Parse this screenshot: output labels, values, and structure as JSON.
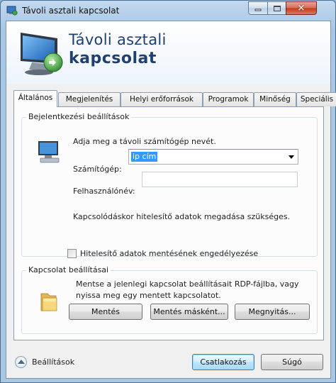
{
  "window": {
    "title": "Távoli asztali kapcsolat"
  },
  "banner": {
    "line1": "Távoli asztali",
    "line2": "kapcsolat"
  },
  "tabs": [
    {
      "label": "Általános",
      "active": true
    },
    {
      "label": "Megjelenítés",
      "active": false
    },
    {
      "label": "Helyi erőforrások",
      "active": false
    },
    {
      "label": "Programok",
      "active": false
    },
    {
      "label": "Minőség",
      "active": false
    },
    {
      "label": "Speciális",
      "active": false
    }
  ],
  "login": {
    "group_title": "Bejelentkezési beállítások",
    "intro": "Adja meg a távoli számítógép nevét.",
    "computer_label": "Számítógép:",
    "computer_value": "ip cím",
    "username_label": "Felhasználónév:",
    "username_value": "",
    "credentials_note": "Kapcsolódáskor hitelesítő adatok megadása szükséges.",
    "save_credentials_label": "Hitelesítő adatok mentésének engedélyezése",
    "save_credentials_checked": false
  },
  "connection": {
    "group_title": "Kapcsolat beállításai",
    "description_line1": "Mentse a jelenlegi kapcsolat beállításait RDP-fájlba, vagy",
    "description_line2": "nyissa meg egy mentett kapcsolatot.",
    "save_button": "Mentés",
    "save_as_button": "Mentés másként...",
    "open_button": "Megnyitás..."
  },
  "footer": {
    "options_label": "Beállítások",
    "connect_button": "Csatlakozás",
    "help_button": "Súgó"
  },
  "colors": {
    "accent": "#1f3f70",
    "selection": "#3399ff",
    "frame": "#a9c6e3"
  }
}
